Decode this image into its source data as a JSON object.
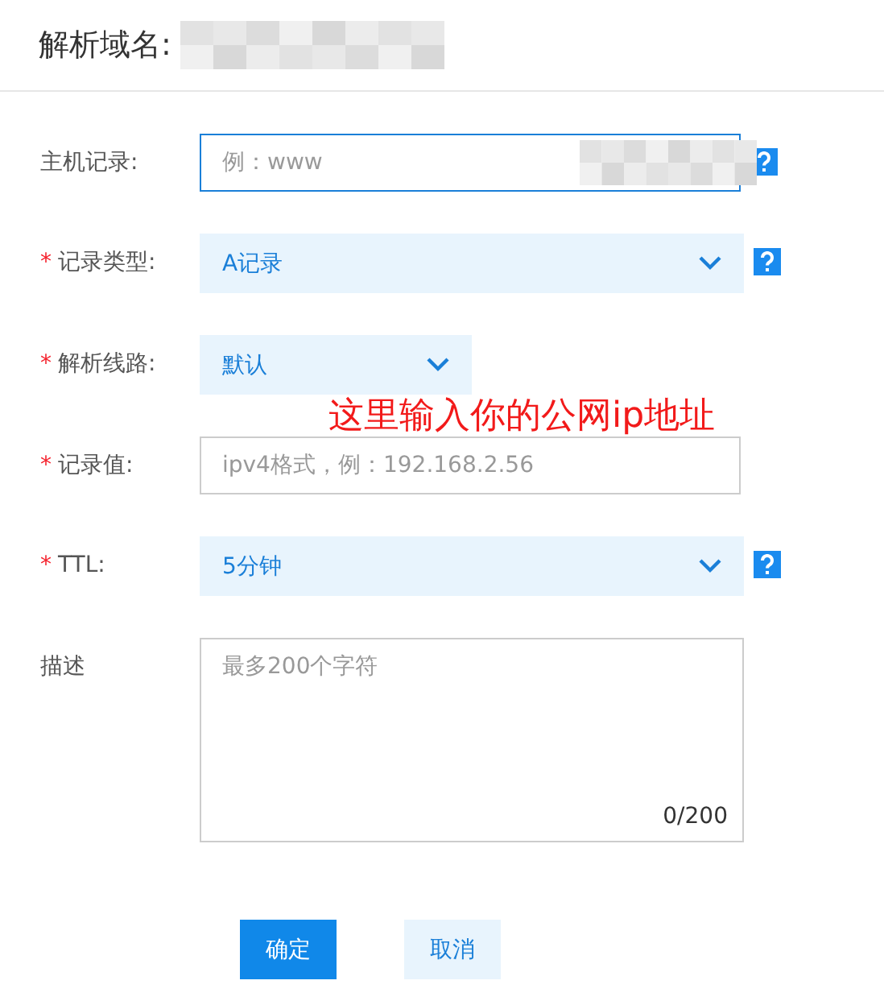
{
  "header": {
    "title": "解析域名:"
  },
  "fields": [
    {
      "kind": "input",
      "label": "主机记录:",
      "placeholder": "例：www",
      "focused": true,
      "help": true
    },
    {
      "kind": "select",
      "label": "记录类型:",
      "required_mark": "*",
      "value": "A记录",
      "help": true
    },
    {
      "kind": "select_short",
      "label": "解析线路:",
      "required_mark": "*",
      "value": "默认",
      "help": false
    },
    {
      "kind": "input",
      "label": "记录值:",
      "required_mark": "*",
      "placeholder": "ipv4格式，例：192.168.2.56",
      "focused": false,
      "help": false,
      "annotation": "这里输入你的公网ip地址"
    },
    {
      "kind": "select",
      "label": "TTL:",
      "required_mark": "*",
      "value": "5分钟",
      "help": true
    },
    {
      "kind": "textarea",
      "label": "描述",
      "placeholder": "最多200个字符",
      "counter": "0/200",
      "help": false
    }
  ],
  "buttons": [
    {
      "kind": "primary",
      "label": "确定"
    },
    {
      "kind": "secondary",
      "label": "取消"
    }
  ]
}
